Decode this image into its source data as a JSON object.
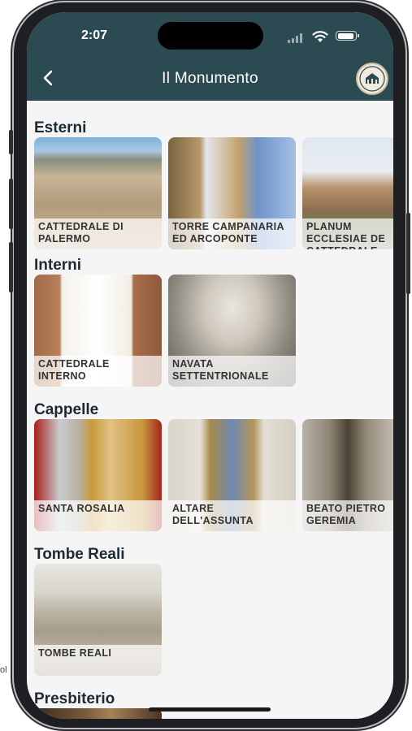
{
  "status": {
    "time": "2:07"
  },
  "nav": {
    "title": "Il Monumento",
    "back_icon": "chevron-left-icon",
    "logo_icon": "monument-logo-icon"
  },
  "sections": [
    {
      "title": "Esterni",
      "cards": [
        {
          "label": "CATTEDRALE DI PALERMO"
        },
        {
          "label": "TORRE CAMPANARIA ED ARCOPONTE"
        },
        {
          "label": "PLANUM ECCLESIAE DE CATTEDRALE"
        }
      ]
    },
    {
      "title": "Interni",
      "cards": [
        {
          "label": "CATTEDRALE INTERNO"
        },
        {
          "label": "NAVATA SETTENTRIONALE"
        }
      ]
    },
    {
      "title": "Cappelle",
      "cards": [
        {
          "label": "SANTA ROSALIA"
        },
        {
          "label": "ALTARE DELL'ASSUNTA"
        },
        {
          "label": "BEATO PIETRO GEREMIA"
        }
      ]
    },
    {
      "title": "Tombe Reali",
      "cards": [
        {
          "label": "TOMBE REALI"
        }
      ]
    },
    {
      "title": "Presbiterio",
      "cards": []
    }
  ],
  "colors": {
    "header": "#2c4a52",
    "section_title": "#1e2a31",
    "background": "#f5f5f5"
  }
}
